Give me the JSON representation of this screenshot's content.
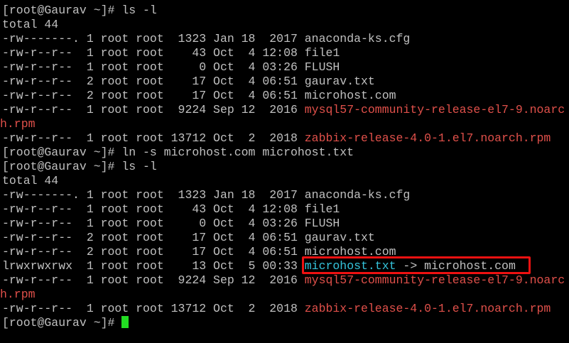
{
  "terminal": {
    "prompt": "[root@Gaurav ~]# ",
    "commands": {
      "ls1": "ls -l",
      "ln": "ln -s microhost.com microhost.txt",
      "ls2": "ls -l"
    },
    "total": "total 44",
    "listing1": [
      {
        "meta": "-rw-------. 1 root root  1323 Jan 18  2017 ",
        "name": "anaconda-ks.cfg",
        "color": "default"
      },
      {
        "meta": "-rw-r--r--  1 root root    43 Oct  4 12:08 ",
        "name": "file1",
        "color": "default"
      },
      {
        "meta": "-rw-r--r--  1 root root     0 Oct  4 03:26 ",
        "name": "FLUSH",
        "color": "default"
      },
      {
        "meta": "-rw-r--r--  2 root root    17 Oct  4 06:51 ",
        "name": "gaurav.txt",
        "color": "default"
      },
      {
        "meta": "-rw-r--r--  2 root root    17 Oct  4 06:51 ",
        "name": "microhost.com",
        "color": "default"
      },
      {
        "meta": "-rw-r--r--  1 root root  9224 Sep 12  2016 ",
        "name": "mysql57-community-release-el7-9.noarc",
        "wrap": "h.rpm",
        "color": "red"
      },
      {
        "meta": "-rw-r--r--  1 root root 13712 Oct  2  2018 ",
        "name": "zabbix-release-4.0-1.el7.noarch.rpm",
        "color": "red"
      }
    ],
    "listing2": [
      {
        "meta": "-rw-------. 1 root root  1323 Jan 18  2017 ",
        "name": "anaconda-ks.cfg",
        "color": "default"
      },
      {
        "meta": "-rw-r--r--  1 root root    43 Oct  4 12:08 ",
        "name": "file1",
        "color": "default"
      },
      {
        "meta": "-rw-r--r--  1 root root     0 Oct  4 03:26 ",
        "name": "FLUSH",
        "color": "default"
      },
      {
        "meta": "-rw-r--r--  2 root root    17 Oct  4 06:51 ",
        "name": "gaurav.txt",
        "color": "default"
      },
      {
        "meta": "-rw-r--r--  2 root root    17 Oct  4 06:51 ",
        "name": "microhost.com",
        "color": "default"
      },
      {
        "meta": "lrwxrwxrwx  1 root root    13 Oct  5 00:33 ",
        "name": "microhost.txt",
        "target": " -> microhost.com",
        "color": "cyan",
        "highlighted": true
      },
      {
        "meta": "-rw-r--r--  1 root root  9224 Sep 12  2016 ",
        "name": "mysql57-community-release-el7-9.noarc",
        "wrap": "h.rpm",
        "color": "red"
      },
      {
        "meta": "-rw-r--r--  1 root root 13712 Oct  2  2018 ",
        "name": "zabbix-release-4.0-1.el7.noarch.rpm",
        "color": "red"
      }
    ]
  },
  "colors": {
    "background": "#000000",
    "text": "#c0c0c0",
    "archive": "#e0504a",
    "symlink": "#35c4dc",
    "cursor": "#22dd22",
    "highlight_box": "#ee1111"
  }
}
